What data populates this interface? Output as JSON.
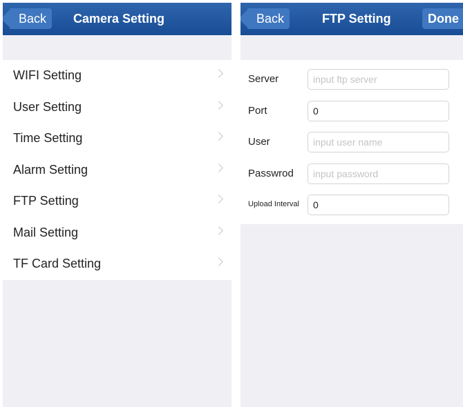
{
  "left": {
    "nav": {
      "back_label": "Back",
      "title": "Camera Setting"
    },
    "items": [
      {
        "label": "WIFI Setting"
      },
      {
        "label": "User Setting"
      },
      {
        "label": "Time Setting"
      },
      {
        "label": "Alarm Setting"
      },
      {
        "label": "FTP Setting"
      },
      {
        "label": "Mail Setting"
      },
      {
        "label": "TF Card Setting"
      }
    ]
  },
  "right": {
    "nav": {
      "back_label": "Back",
      "title": "FTP Setting",
      "done_label": "Done"
    },
    "fields": [
      {
        "label": "Server",
        "value": "",
        "placeholder": "input ftp server"
      },
      {
        "label": "Port",
        "value": "0",
        "placeholder": ""
      },
      {
        "label": "User",
        "value": "",
        "placeholder": "input user name"
      },
      {
        "label": "Passwrod",
        "value": "",
        "placeholder": "input password"
      },
      {
        "label": "Upload Interval",
        "value": "0",
        "placeholder": ""
      }
    ]
  },
  "colors": {
    "nav_bar": "#1f57a0",
    "back_button": "#3f77c0",
    "background": "#efeff4",
    "chevron": "#c7c7cc"
  },
  "icons": {
    "back": "back-arrow-icon",
    "row_chevron": "chevron-right-icon"
  }
}
